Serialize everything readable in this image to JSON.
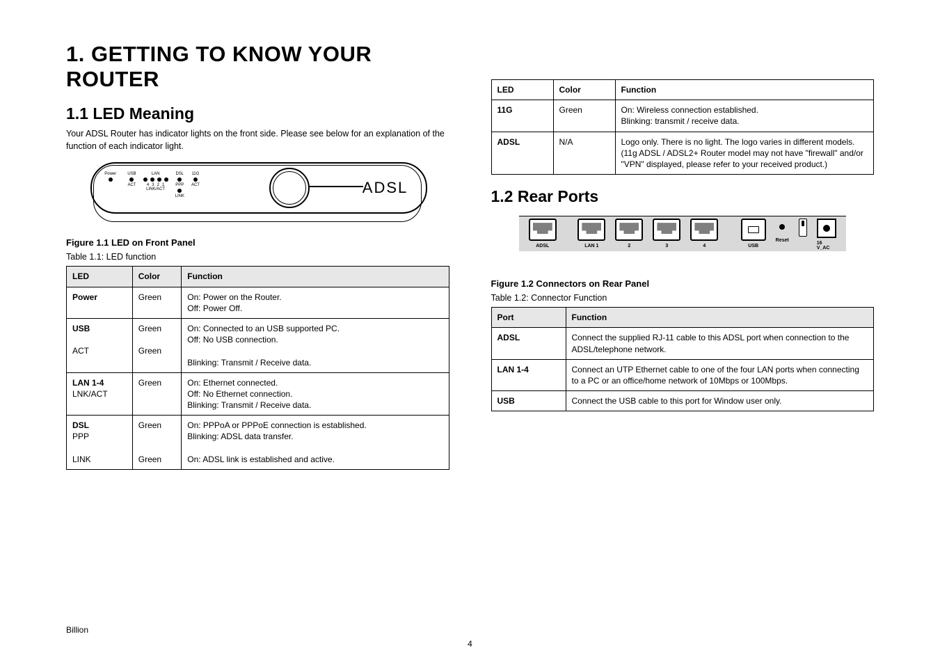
{
  "page": {
    "title": "1. GETTING TO KNOW YOUR ROUTER",
    "footer_brand": "Billion",
    "footer_page": "4"
  },
  "front": {
    "section_heading": "1.1 LED Meaning",
    "figure_caption": "Figure 1.1 LED on Front Panel",
    "brand_text": "ADSL",
    "labels": {
      "power": "Power",
      "usb": "USB",
      "lan": "LAN",
      "dsl": "DSL",
      "eleven_g": "11G",
      "act": "ACT",
      "link_act": "LINK/ACT",
      "ppp": "PPP",
      "link": "LINK",
      "lan_ports": [
        "4",
        "3",
        "2",
        "1"
      ]
    }
  },
  "led_table": {
    "headers": [
      "LED",
      "Color",
      "Function"
    ],
    "rows": [
      {
        "led": "Power",
        "color": "Green",
        "function": "On: Power on the Router.\nOff: Power Off."
      },
      {
        "led": "USB",
        "color": "Green",
        "function": "On: Connected to an USB supported PC.\nOff: No USB connection.\n\nBlinking: Transmit / Receive data.",
        "note_label": "ACT",
        "note_color": "Green"
      },
      {
        "led": "LAN 1-4",
        "color": "Green",
        "function": "On: Ethernet connected.\nOff: No Ethernet connection.\nBlinking: Transmit / Receive data.",
        "sub_label": "LNK/ACT"
      },
      {
        "led": "DSL",
        "color": "Green",
        "function": "On: PPPoA or PPPoE connection is established.\nBlinking: ADSL data transfer.\n\nOn: ADSL link is established and active.",
        "sub_label_a": "PPP",
        "sub_label_b": "LINK",
        "sub_color_b": "Green"
      }
    ]
  },
  "led_table2": {
    "rows": [
      {
        "led": "11G",
        "color": "Green",
        "function": "On: Wireless connection established.\nBlinking: transmit / receive data."
      },
      {
        "led": "ADSL",
        "color": "N/A",
        "function": "Logo only. There is no light. The logo varies in different models. (11g ADSL / ADSL2+ Router model may not have \"firewall\" and/or \"VPN\" displayed, please refer to your received product.)"
      }
    ]
  },
  "rear": {
    "section_heading": "1.2 Rear Ports",
    "figure_caption": "Figure 1.2 Connectors on Rear Panel",
    "ports": {
      "adsl": "ADSL",
      "lan1": "LAN 1",
      "p2": "2",
      "p3": "3",
      "p4": "4",
      "usb": "USB",
      "reset": "Reset",
      "power": "16 V_AC"
    }
  },
  "rear_table": {
    "headers": [
      "Port",
      "Function"
    ],
    "rows": [
      {
        "port": "ADSL",
        "function": "Connect the supplied RJ-11 cable to this ADSL port when connection to the ADSL/telephone network."
      },
      {
        "port": "LAN 1-4",
        "function": "Connect an UTP Ethernet cable to one of the four LAN ports when connecting to a PC or an office/home network of 10Mbps or 100Mbps."
      },
      {
        "port": "USB",
        "function": "Connect the USB cable to this port for Window user only."
      }
    ]
  }
}
